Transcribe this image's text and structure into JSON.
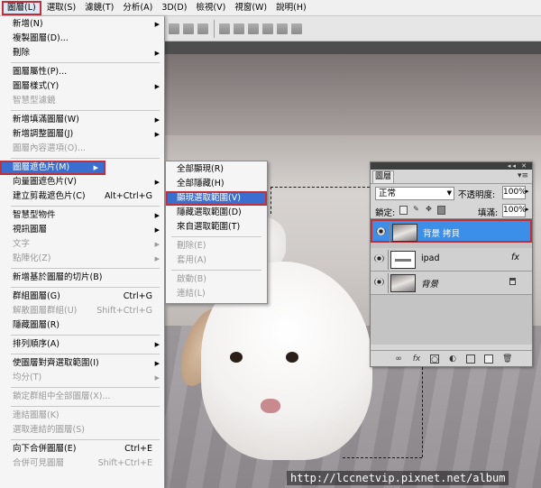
{
  "menubar": {
    "items": [
      {
        "label": "圖層(L)",
        "active": true
      },
      {
        "label": "選取(S)"
      },
      {
        "label": "濾鏡(T)"
      },
      {
        "label": "分析(A)"
      },
      {
        "label": "3D(D)"
      },
      {
        "label": "檢視(V)"
      },
      {
        "label": "視窗(W)"
      },
      {
        "label": "說明(H)"
      }
    ]
  },
  "menu": {
    "items": [
      {
        "label": "新增(N)",
        "arrow": true
      },
      {
        "label": "複製圖層(D)..."
      },
      {
        "label": "刪除",
        "arrow": true
      },
      {
        "sep": true
      },
      {
        "label": "圖層屬性(P)..."
      },
      {
        "label": "圖層樣式(Y)",
        "arrow": true
      },
      {
        "label": "智慧型濾鏡",
        "disabled": true
      },
      {
        "sep": true
      },
      {
        "label": "新增填滿圖層(W)",
        "arrow": true
      },
      {
        "label": "新增調整圖層(J)",
        "arrow": true
      },
      {
        "label": "圖層內容選項(O)...",
        "disabled": true
      },
      {
        "sep": true
      },
      {
        "label": "圖層遮色片(M)",
        "arrow": true,
        "highlight": true
      },
      {
        "label": "向量圖遮色片(V)",
        "arrow": true
      },
      {
        "label": "建立剪裁遮色片(C)",
        "shortcut": "Alt+Ctrl+G"
      },
      {
        "sep": true
      },
      {
        "label": "智慧型物件",
        "arrow": true
      },
      {
        "label": "視訊圖層",
        "arrow": true
      },
      {
        "label": "文字",
        "arrow": true,
        "disabled": true
      },
      {
        "label": "點陣化(Z)",
        "arrow": true,
        "disabled": true
      },
      {
        "sep": true
      },
      {
        "label": "新增基於圖層的切片(B)"
      },
      {
        "sep": true
      },
      {
        "label": "群組圖層(G)",
        "shortcut": "Ctrl+G"
      },
      {
        "label": "解散圖層群組(U)",
        "shortcut": "Shift+Ctrl+G",
        "disabled": true
      },
      {
        "label": "隱藏圖層(R)"
      },
      {
        "sep": true
      },
      {
        "label": "排列順序(A)",
        "arrow": true
      },
      {
        "sep": true
      },
      {
        "label": "使圖層對齊選取範圍(I)",
        "arrow": true
      },
      {
        "label": "均分(T)",
        "arrow": true,
        "disabled": true
      },
      {
        "sep": true
      },
      {
        "label": "鎖定群組中全部圖層(X)...",
        "disabled": true
      },
      {
        "sep": true
      },
      {
        "label": "連結圖層(K)",
        "disabled": true
      },
      {
        "label": "選取連結的圖層(S)",
        "disabled": true
      },
      {
        "sep": true
      },
      {
        "label": "向下合併圖層(E)",
        "shortcut": "Ctrl+E"
      },
      {
        "label": "合併可見圖層",
        "shortcut": "Shift+Ctrl+E",
        "disabled": true
      }
    ]
  },
  "submenu": {
    "items": [
      {
        "label": "全部顯現(R)"
      },
      {
        "label": "全部隱藏(H)"
      },
      {
        "label": "顯現選取範圍(V)",
        "highlight": true
      },
      {
        "label": "隱藏選取範圍(D)"
      },
      {
        "label": "來自選取範圍(T)"
      },
      {
        "sep": true
      },
      {
        "label": "刪除(E)",
        "disabled": true
      },
      {
        "label": "套用(A)",
        "disabled": true
      },
      {
        "sep": true
      },
      {
        "label": "啟動(B)",
        "disabled": true
      },
      {
        "label": "連結(L)",
        "disabled": true
      }
    ]
  },
  "layers_panel": {
    "tab": "圖層",
    "blend_mode": "正常",
    "opacity_label": "不透明度:",
    "opacity": "100%",
    "lock_label": "鎖定:",
    "fill_label": "填滿:",
    "fill": "100%",
    "layers": [
      {
        "name": "背景 拷貝",
        "selected": true,
        "kind": "photo"
      },
      {
        "name": "ipad",
        "fx": "fx",
        "kind": "text"
      },
      {
        "name": "背景",
        "lock": true,
        "kind": "photo",
        "italic": true
      }
    ]
  },
  "watermark": "http://lccnetvip.pixnet.net/album",
  "colors": {
    "highlight": "#3a6fd0",
    "selection_outline": "#c0303a",
    "layer_selected": "#3b8fe8"
  }
}
